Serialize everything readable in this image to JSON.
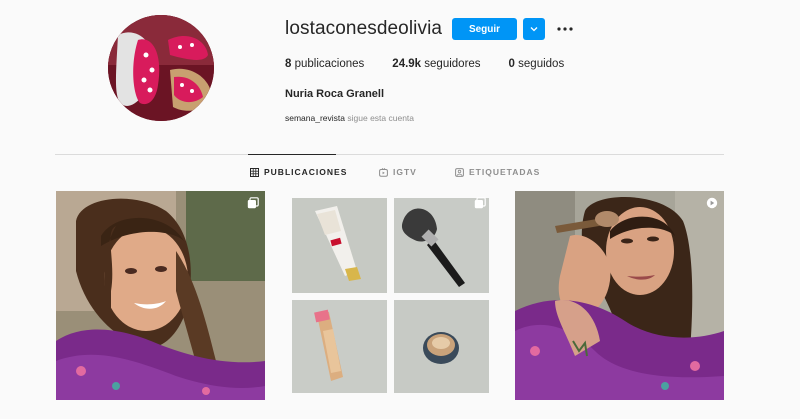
{
  "profile": {
    "username": "lostaconesdeolivia",
    "full_name": "Nuria Roca Granell",
    "follow_label": "Seguir",
    "avatar_icon": "avatar-image",
    "stats": [
      {
        "value": "8",
        "label": "publicaciones"
      },
      {
        "value": "24.9k",
        "label": "seguidores"
      },
      {
        "value": "0",
        "label": "seguidos"
      }
    ],
    "followed_by": {
      "user": "semana_revista",
      "text": "sigue esta cuenta"
    }
  },
  "tabs": [
    {
      "label": "PUBLICACIONES",
      "icon": "grid-icon",
      "active": true
    },
    {
      "label": "IGTV",
      "icon": "igtv-icon",
      "active": false
    },
    {
      "label": "ETIQUETADAS",
      "icon": "tagged-icon",
      "active": false
    }
  ],
  "colors": {
    "accent": "#0095f6",
    "text": "#262626",
    "muted": "#8e8e8e",
    "divider": "#dbdbdb",
    "background": "#fafafa"
  },
  "posts": [
    {
      "content": "selfie-woman-purple-robe",
      "badge": "carousel-icon"
    },
    {
      "content": "makeup-products-grid",
      "badge": "carousel-icon"
    },
    {
      "content": "woman-applying-makeup-brush",
      "badge": "video-icon"
    }
  ]
}
